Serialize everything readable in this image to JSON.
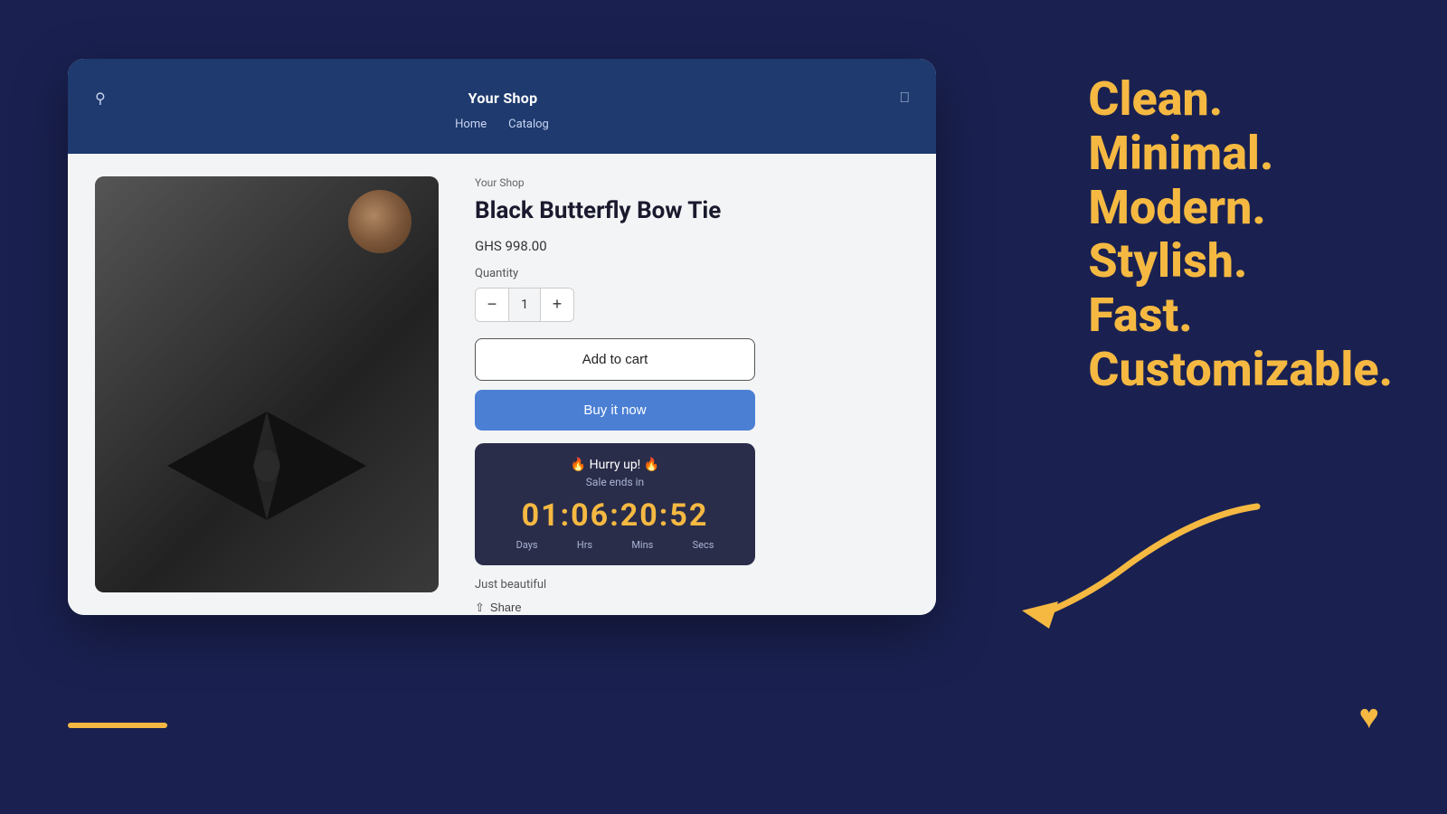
{
  "background_color": "#1a2151",
  "browser": {
    "nav": {
      "shop_title": "Your Shop",
      "links": [
        "Home",
        "Catalog"
      ]
    }
  },
  "product": {
    "breadcrumb": "Your Shop",
    "name": "Black Butterfly Bow Tie",
    "price": "GHS 998.00",
    "quantity_label": "Quantity",
    "quantity_value": "1",
    "qty_decrease": "−",
    "qty_increase": "+",
    "add_to_cart": "Add to cart",
    "buy_it_now": "Buy it now",
    "countdown": {
      "hurry": "🔥 Hurry up! 🔥",
      "subtitle": "Sale ends in",
      "time": "01:06:20:52",
      "labels": [
        "Days",
        "Hrs",
        "Mins",
        "Secs"
      ]
    },
    "description": "Just beautiful",
    "share": "Share"
  },
  "tagline": {
    "lines": [
      "Clean.",
      "Minimal.",
      "Modern.",
      "Stylish.",
      "Fast.",
      "Customizable."
    ]
  },
  "bottom_bar_color": "#f5b942",
  "heart_icon": "♥"
}
